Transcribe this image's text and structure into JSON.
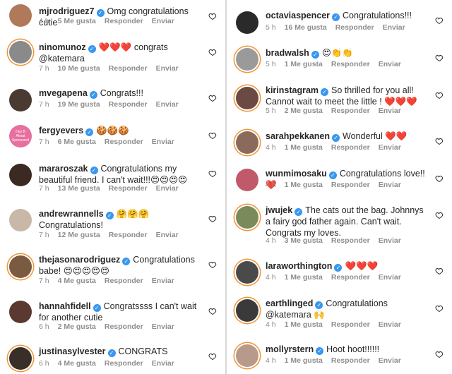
{
  "labels": {
    "reply": "Responder",
    "send": "Enviar"
  },
  "left": [
    {
      "user": "mjrodriguez7",
      "text": "Omg congratulations cutie",
      "time": "4 h",
      "likes": "5 Me gusta",
      "avatar_color": "#b07a5a",
      "story": false
    },
    {
      "user": "ninomunoz",
      "text": "❤️❤️❤️ congrats @katemara",
      "time": "7 h",
      "likes": "10 Me gusta",
      "avatar_color": "#8a8a8a",
      "story": true
    },
    {
      "user": "mvegapena",
      "text": "Congrats!!!",
      "time": "7 h",
      "likes": "19 Me gusta",
      "avatar_color": "#4a3b32",
      "story": false
    },
    {
      "user": "fergyevers",
      "text": "🍪🍪🍪",
      "time": "7 h",
      "likes": "6 Me gusta",
      "avatar_color": "#e86fa0",
      "avatar_text": "Hey B Ahoat Sponsored",
      "story": false
    },
    {
      "user": "mararoszak",
      "text": "Congratulations my beautiful friend. I can't wait!!!😍😍😍😍",
      "time": "7 h",
      "likes": "13 Me gusta",
      "avatar_color": "#3a2a22",
      "story": false
    },
    {
      "user": "andrewrannells",
      "text": "🤗🤗🤗 Congratulations!",
      "time": "7 h",
      "likes": "12 Me gusta",
      "avatar_color": "#c9b8a8",
      "story": false
    },
    {
      "user": "thejasonarodriguez",
      "text": "Congratulations babe! 😍😍😍😍😍",
      "time": "7 h",
      "likes": "4 Me gusta",
      "avatar_color": "#7a5a40",
      "story": true
    },
    {
      "user": "hannahfidell",
      "text": "Congratssss I can't wait for another cutie",
      "time": "6 h",
      "likes": "2 Me gusta",
      "avatar_color": "#5a3a30",
      "story": false
    },
    {
      "user": "justinasylvester",
      "text": "CONGRATS",
      "time": "6 h",
      "likes": "4 Me gusta",
      "avatar_color": "#3a2e28",
      "story": true
    }
  ],
  "right": [
    {
      "user": "octaviaspencer",
      "text": "Congratulations!!!",
      "time": "5 h",
      "likes": "16 Me gusta",
      "avatar_color": "#2a2a2a",
      "story": false
    },
    {
      "user": "bradwalsh",
      "text": "😍👏👏",
      "time": "5 h",
      "likes": "1 Me gusta",
      "avatar_color": "#9a9a9a",
      "story": true
    },
    {
      "user": "kirinstagram",
      "text": "So thrilled for you all! Cannot wait to meet the little ! ❤️❤️❤️",
      "time": "5 h",
      "likes": "2 Me gusta",
      "avatar_color": "#6a4a42",
      "story": true
    },
    {
      "user": "sarahpekkanen",
      "text": "Wonderful ❤️❤️",
      "time": "4 h",
      "likes": "1 Me gusta",
      "avatar_color": "#8a6a5a",
      "story": true
    },
    {
      "user": "wunmimosaku",
      "text": "Congratulations love!! ❤️",
      "time": "4 h",
      "likes": "1 Me gusta",
      "avatar_color": "#c05a6a",
      "story": false
    },
    {
      "user": "jwujek",
      "text": "The cats out the bag.  Johnnys a fairy god father again.  Can't wait. Congrats my loves.",
      "time": "4 h",
      "likes": "3 Me gusta",
      "avatar_color": "#7a8a5a",
      "story": true
    },
    {
      "user": "laraworthington",
      "text": "❤️❤️❤️",
      "time": "4 h",
      "likes": "1 Me gusta",
      "avatar_color": "#4a4a4a",
      "story": true
    },
    {
      "user": "earthlinged",
      "text": "Congratulations @katemara 🙌",
      "time": "4 h",
      "likes": "1 Me gusta",
      "avatar_color": "#3a3a3a",
      "story": true
    },
    {
      "user": "mollyrstern",
      "text": "Hoot hoot!!!!!!",
      "time": "4 h",
      "likes": "1 Me gusta",
      "avatar_color": "#b89a8a",
      "story": true
    }
  ]
}
